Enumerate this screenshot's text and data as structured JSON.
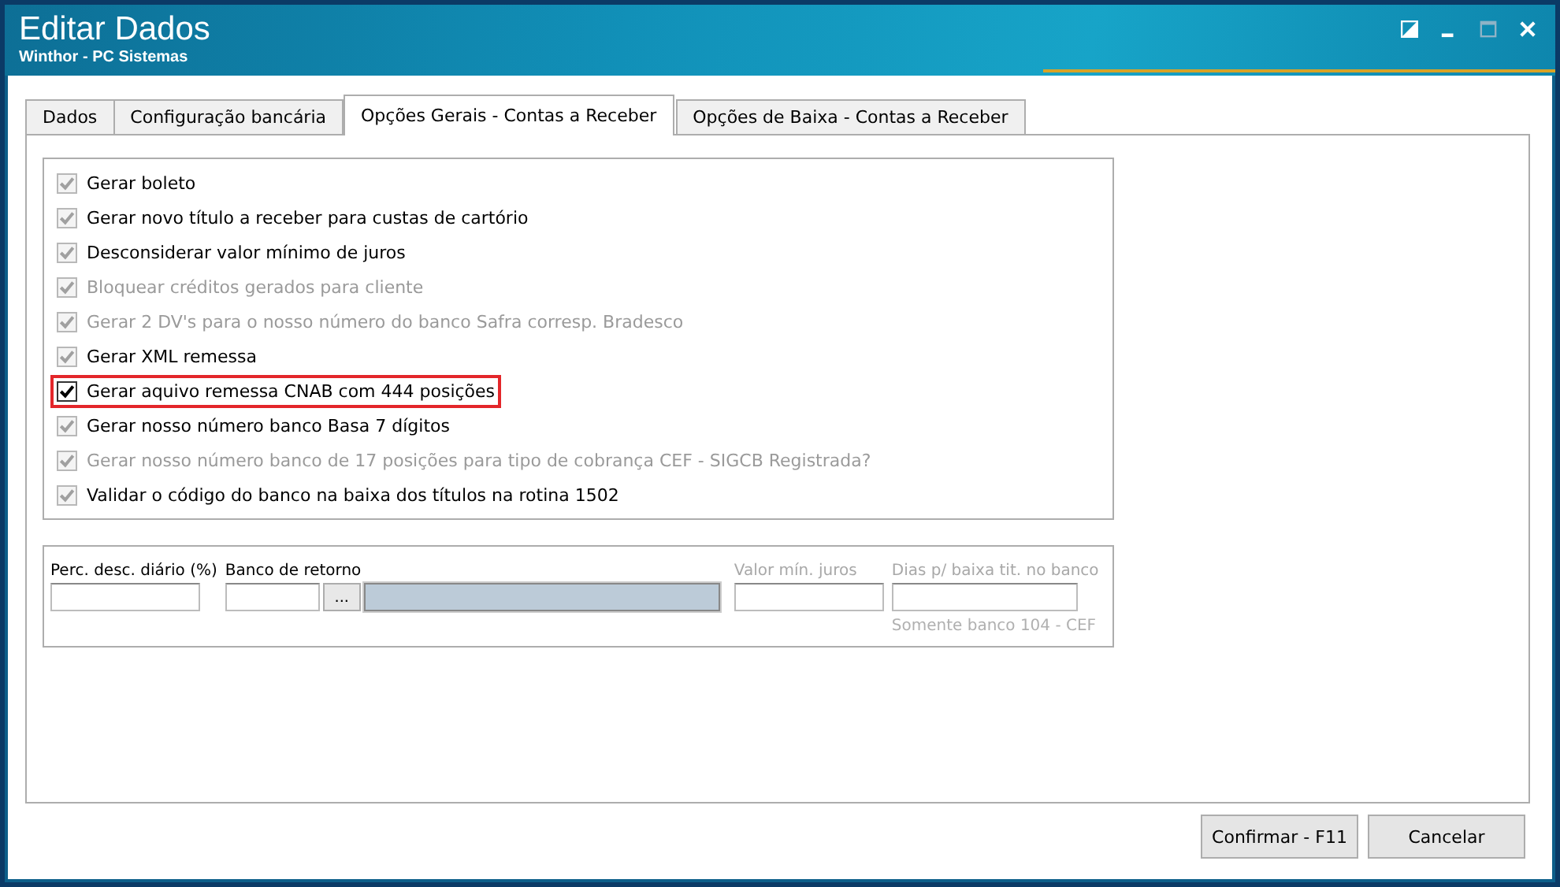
{
  "window": {
    "title": "Editar Dados",
    "subtitle": "Winthor - PC Sistemas"
  },
  "tabs": [
    {
      "label": "Dados",
      "selected": false
    },
    {
      "label": "Configuração bancária",
      "selected": false
    },
    {
      "label": "Opções Gerais - Contas a Receber",
      "selected": true
    },
    {
      "label": "Opções de Baixa - Contas a Receber",
      "selected": false
    }
  ],
  "options": [
    {
      "label": "Gerar boleto",
      "checked": true,
      "disabled": false,
      "highlighted": false
    },
    {
      "label": "Gerar novo título a receber para custas de cartório",
      "checked": true,
      "disabled": false,
      "highlighted": false
    },
    {
      "label": "Desconsiderar valor mínimo de juros",
      "checked": true,
      "disabled": false,
      "highlighted": false
    },
    {
      "label": "Bloquear créditos gerados para cliente",
      "checked": true,
      "disabled": true,
      "highlighted": false
    },
    {
      "label": "Gerar 2 DV's para o nosso número do banco Safra corresp. Bradesco",
      "checked": true,
      "disabled": true,
      "highlighted": false
    },
    {
      "label": "Gerar XML remessa",
      "checked": true,
      "disabled": false,
      "highlighted": false
    },
    {
      "label": "Gerar aquivo remessa CNAB com 444 posições",
      "checked": true,
      "disabled": false,
      "highlighted": true
    },
    {
      "label": "Gerar nosso número banco Basa 7 dígitos",
      "checked": true,
      "disabled": false,
      "highlighted": false
    },
    {
      "label": "Gerar nosso número banco de 17 posições para tipo de cobrança CEF - SIGCB Registrada?",
      "checked": true,
      "disabled": true,
      "highlighted": false
    },
    {
      "label": "Validar o código do banco na baixa dos títulos na rotina 1502",
      "checked": true,
      "disabled": false,
      "highlighted": false
    }
  ],
  "fields": [
    {
      "label": "Perc. desc. diário (%)",
      "kind": "text",
      "disabled": false
    },
    {
      "label": "Banco de retorno",
      "kind": "lookup",
      "disabled": false,
      "button": "..."
    },
    {
      "label": "Valor mín. juros",
      "kind": "text",
      "disabled": true
    },
    {
      "label": "Dias p/ baixa tit. no banco",
      "kind": "text",
      "disabled": true,
      "hint": "Somente banco 104 - CEF"
    }
  ],
  "buttons": [
    "Confirmar - F11",
    "Cancelar"
  ]
}
